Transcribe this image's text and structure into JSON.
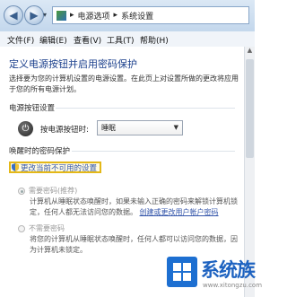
{
  "breadcrumb": {
    "parent": "电源选项",
    "current": "系统设置",
    "separator": "▸"
  },
  "menu": [
    "文件(F)",
    "编辑(E)",
    "查看(V)",
    "工具(T)",
    "帮助(H)"
  ],
  "page": {
    "title": "定义电源按钮并启用密码保护",
    "intro": "选择要为您的计算机设置的电源设置。在此页上对设置所做的更改将应用于您的所有电源计划。"
  },
  "power_buttons": {
    "heading": "电源按钮设置",
    "label": "按电源按钮时:",
    "selected": "睡眠"
  },
  "password": {
    "heading": "唤醒时的密码保护",
    "change_link": "更改当前不可用的设置",
    "options": [
      {
        "label": "需要密码(推荐)",
        "desc": "计算机从睡眠状态唤醒时，如果未输入正确的密码来解锁计算机锁定，任何人都无法访问您的数据。",
        "link": "创建或更改用户帐户密码"
      },
      {
        "label": "不需要密码",
        "desc": "将您的计算机从睡眠状态唤醒时，任何人都可以访问您的数据，因为计算机未锁定。"
      }
    ]
  },
  "watermark": {
    "text": "系统族",
    "url": "www.xitongzu.com"
  }
}
